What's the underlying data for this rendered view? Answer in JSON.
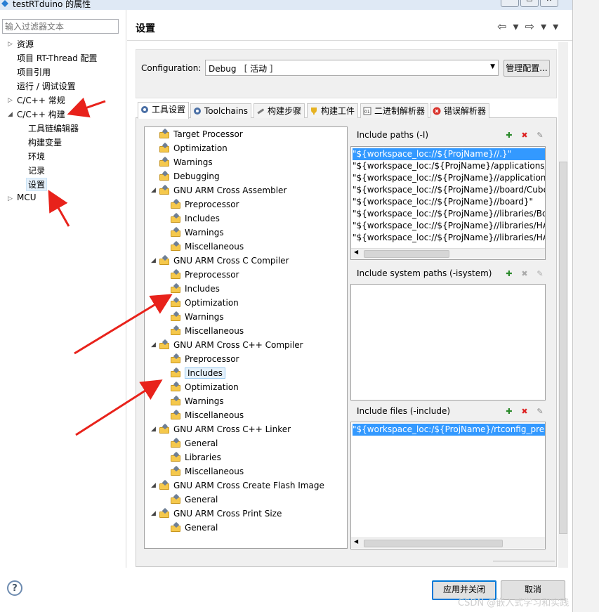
{
  "window": {
    "title": "testRTduino 的属性",
    "min_label": "—",
    "max_label": "☐",
    "close_label": "✕"
  },
  "filter": {
    "placeholder": "输入过滤器文本"
  },
  "nav": {
    "items": [
      {
        "label": "资源"
      },
      {
        "label": "项目 RT-Thread 配置"
      },
      {
        "label": "项目引用"
      },
      {
        "label": "运行 / 调试设置"
      },
      {
        "label": "C/C++ 常规"
      },
      {
        "label": "C/C++ 构建"
      },
      {
        "label": "工具链编辑器"
      },
      {
        "label": "构建变量"
      },
      {
        "label": "环境"
      },
      {
        "label": "记录"
      },
      {
        "label": "设置"
      },
      {
        "label": "MCU"
      }
    ],
    "selected": "设置"
  },
  "page": {
    "title": "设置",
    "nav_arrows": "⇦ ▾ ⇨ ▾ ▾"
  },
  "config": {
    "label": "Configuration:",
    "value": "Debug ［ 活动 ］",
    "manage_button": "管理配置..."
  },
  "tabs": [
    {
      "label": "工具设置",
      "icon": "tool-settings-icon",
      "active": true
    },
    {
      "label": "Toolchains",
      "icon": "toolchains-icon",
      "active": false
    },
    {
      "label": "构建步骤",
      "icon": "build-steps-icon",
      "active": false
    },
    {
      "label": "构建工件",
      "icon": "build-artifact-icon",
      "active": false
    },
    {
      "label": "二进制解析器",
      "icon": "binary-parser-icon",
      "active": false
    },
    {
      "label": "错误解析器",
      "icon": "error-parser-icon",
      "active": false
    }
  ],
  "tree": {
    "items": [
      {
        "label": "Target Processor",
        "level": 0,
        "expanded": null
      },
      {
        "label": "Optimization",
        "level": 0,
        "expanded": null
      },
      {
        "label": "Warnings",
        "level": 0,
        "expanded": null
      },
      {
        "label": "Debugging",
        "level": 0,
        "expanded": null
      },
      {
        "label": "GNU ARM Cross Assembler",
        "level": 0,
        "expanded": true
      },
      {
        "label": "Preprocessor",
        "level": 1,
        "expanded": null
      },
      {
        "label": "Includes",
        "level": 1,
        "expanded": null
      },
      {
        "label": "Warnings",
        "level": 1,
        "expanded": null
      },
      {
        "label": "Miscellaneous",
        "level": 1,
        "expanded": null
      },
      {
        "label": "GNU ARM Cross C Compiler",
        "level": 0,
        "expanded": true
      },
      {
        "label": "Preprocessor",
        "level": 1,
        "expanded": null
      },
      {
        "label": "Includes",
        "level": 1,
        "expanded": null
      },
      {
        "label": "Optimization",
        "level": 1,
        "expanded": null
      },
      {
        "label": "Warnings",
        "level": 1,
        "expanded": null
      },
      {
        "label": "Miscellaneous",
        "level": 1,
        "expanded": null
      },
      {
        "label": "GNU ARM Cross C++ Compiler",
        "level": 0,
        "expanded": true
      },
      {
        "label": "Preprocessor",
        "level": 1,
        "expanded": null
      },
      {
        "label": "Includes",
        "level": 1,
        "expanded": null,
        "selected": true
      },
      {
        "label": "Optimization",
        "level": 1,
        "expanded": null
      },
      {
        "label": "Warnings",
        "level": 1,
        "expanded": null
      },
      {
        "label": "Miscellaneous",
        "level": 1,
        "expanded": null
      },
      {
        "label": "GNU ARM Cross C++ Linker",
        "level": 0,
        "expanded": true
      },
      {
        "label": "General",
        "level": 1,
        "expanded": null
      },
      {
        "label": "Libraries",
        "level": 1,
        "expanded": null
      },
      {
        "label": "Miscellaneous",
        "level": 1,
        "expanded": null
      },
      {
        "label": "GNU ARM Cross Create Flash Image",
        "level": 0,
        "expanded": true
      },
      {
        "label": "General",
        "level": 1,
        "expanded": null
      },
      {
        "label": "GNU ARM Cross Print Size",
        "level": 0,
        "expanded": true
      },
      {
        "label": "General",
        "level": 1,
        "expanded": null
      }
    ]
  },
  "include_paths": {
    "header": "Include paths (-I)",
    "items": [
      "\"${workspace_loc://${ProjName}//.}\"",
      "\"${workspace_loc:/${ProjName}/applications/ar",
      "\"${workspace_loc://${ProjName}//applications}'",
      "\"${workspace_loc://${ProjName}//board/CubeM",
      "\"${workspace_loc://${ProjName}//board}\"",
      "\"${workspace_loc://${ProjName}//libraries/Boa",
      "\"${workspace_loc://${ProjName}//libraries/HAL_",
      "\"${workspace_loc://${ProjName}//libraries/HAL_"
    ]
  },
  "include_system_paths": {
    "header": "Include system paths (-isystem)",
    "items": []
  },
  "include_files": {
    "header": "Include files (-include)",
    "items": [
      "\"${workspace_loc:/${ProjName}/rtconfig_preinc"
    ]
  },
  "buttons": {
    "apply_close": "应用并关闭",
    "cancel": "取消",
    "help": "?"
  },
  "watermark": "CSDN @嵌入式学习和实践",
  "colors": {
    "selection": "#3399ff",
    "annotation_arrow": "#e8221b",
    "folder": "#f5c84c"
  }
}
